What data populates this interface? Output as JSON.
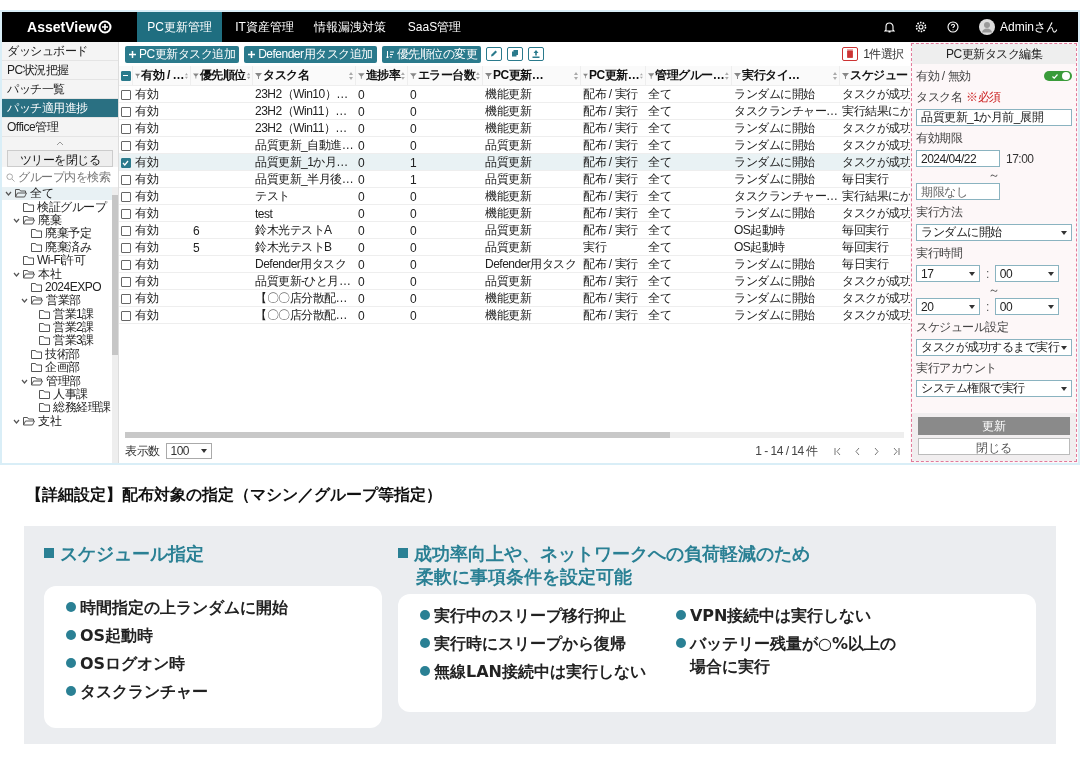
{
  "header": {
    "logo": "AssetView",
    "tabs": [
      {
        "label": "PC更新管理",
        "selected": true
      },
      {
        "label": "IT資産管理",
        "selected": false
      },
      {
        "label": "情報漏洩対策",
        "selected": false
      },
      {
        "label": "SaaS管理",
        "selected": false
      }
    ],
    "user": "Adminさん"
  },
  "sidebar": {
    "menu": [
      {
        "label": "ダッシュボード",
        "selected": false
      },
      {
        "label": "PC状況把握",
        "selected": false
      },
      {
        "label": "パッチ一覧",
        "selected": false
      },
      {
        "label": "パッチ適用進捗",
        "selected": true
      },
      {
        "label": "Office管理",
        "selected": false
      }
    ],
    "collapse_button": "ツリーを閉じる",
    "search": {
      "placeholder": "グループ内を検索"
    },
    "tree": [
      {
        "label": "全て",
        "expanded": true,
        "selected": true,
        "children": [
          {
            "label": "検証グループ",
            "selected": false
          },
          {
            "label": "廃棄",
            "expanded": true,
            "selected": false,
            "children": [
              {
                "label": "廃棄予定",
                "selected": false
              },
              {
                "label": "廃棄済み",
                "selected": false
              }
            ]
          },
          {
            "label": "Wi-Fi許可",
            "selected": false
          },
          {
            "label": "本社",
            "expanded": true,
            "selected": false,
            "children": [
              {
                "label": "2024EXPO",
                "selected": false
              },
              {
                "label": "営業部",
                "expanded": true,
                "selected": false,
                "children": [
                  {
                    "label": "営業1課",
                    "selected": false
                  },
                  {
                    "label": "営業2課",
                    "selected": false
                  },
                  {
                    "label": "営業3課",
                    "selected": false
                  }
                ]
              },
              {
                "label": "技術部",
                "selected": false
              },
              {
                "label": "企画部",
                "selected": false
              },
              {
                "label": "管理部",
                "expanded": true,
                "selected": false,
                "children": [
                  {
                    "label": "人事課",
                    "selected": false
                  },
                  {
                    "label": "総務経理課",
                    "selected": false
                  }
                ]
              }
            ]
          },
          {
            "label": "支社",
            "expanded": true,
            "selected": false
          }
        ]
      }
    ]
  },
  "toolbar": {
    "buttons": [
      "PC更新タスク追加",
      "Defender用タスク追加",
      "優先順位の変更"
    ],
    "selection_count": "1件選択"
  },
  "table": {
    "select_all_indeterminate": true,
    "columns": [
      "有効 / …",
      "優先順位",
      "タスク名",
      "進捗率",
      "エラー台数",
      "PC更新…",
      "PC更新…",
      "管理グルー…",
      "実行タイ…",
      "スケジュー"
    ],
    "rows": [
      {
        "selected": false,
        "cells": [
          "有効",
          null,
          "23H2（Win10）…",
          "0",
          "0",
          "機能更新",
          "配布 / 実行",
          "全て",
          "ランダムに開始",
          "タスクが成功"
        ]
      },
      {
        "selected": false,
        "cells": [
          "有効",
          null,
          "23H2（Win11）…",
          "0",
          "0",
          "機能更新",
          "配布 / 実行",
          "全て",
          "タスクランチャー…",
          "実行結果にか"
        ]
      },
      {
        "selected": false,
        "cells": [
          "有効",
          null,
          "23H2（Win11）…",
          "0",
          "0",
          "機能更新",
          "配布 / 実行",
          "全て",
          "ランダムに開始",
          "タスクが成功"
        ]
      },
      {
        "selected": false,
        "cells": [
          "有効",
          null,
          "品質更新_自動進…",
          "0",
          "0",
          "品質更新",
          "配布 / 実行",
          "全て",
          "ランダムに開始",
          "タスクが成功"
        ]
      },
      {
        "selected": true,
        "cells": [
          "有効",
          null,
          "品質更新_1か月…",
          "0",
          "1",
          "品質更新",
          "配布 / 実行",
          "全て",
          "ランダムに開始",
          "タスクが成功"
        ]
      },
      {
        "selected": false,
        "cells": [
          "有効",
          null,
          "品質更新_半月後…",
          "0",
          "1",
          "品質更新",
          "配布 / 実行",
          "全て",
          "ランダムに開始",
          "毎日実行"
        ]
      },
      {
        "selected": false,
        "cells": [
          "有効",
          null,
          "テスト",
          "0",
          "0",
          "機能更新",
          "配布 / 実行",
          "全て",
          "タスクランチャー…",
          "実行結果にか"
        ]
      },
      {
        "selected": false,
        "cells": [
          "有効",
          null,
          "test",
          "0",
          "0",
          "機能更新",
          "配布 / 実行",
          "全て",
          "ランダムに開始",
          "タスクが成功"
        ]
      },
      {
        "selected": false,
        "cells": [
          "有効",
          "6",
          "鈴木光テストA",
          "0",
          "0",
          "品質更新",
          "配布 / 実行",
          "全て",
          "OS起動時",
          "毎回実行"
        ]
      },
      {
        "selected": false,
        "cells": [
          "有効",
          "5",
          "鈴木光テストB",
          "0",
          "0",
          "品質更新",
          "実行",
          "全て",
          "OS起動時",
          "毎回実行"
        ]
      },
      {
        "selected": false,
        "cells": [
          "有効",
          null,
          "Defender用タスク",
          "0",
          "0",
          "Defender用タスク",
          "配布 / 実行",
          "全て",
          "ランダムに開始",
          "毎日実行"
        ]
      },
      {
        "selected": false,
        "cells": [
          "有効",
          null,
          "品質更新-ひと月…",
          "0",
          "0",
          "品質更新",
          "配布 / 実行",
          "全て",
          "ランダムに開始",
          "タスクが成功"
        ]
      },
      {
        "selected": false,
        "cells": [
          "有効",
          null,
          "【〇〇店分散配…",
          "0",
          "0",
          "機能更新",
          "配布 / 実行",
          "全て",
          "ランダムに開始",
          "タスクが成功"
        ]
      },
      {
        "selected": false,
        "cells": [
          "有効",
          null,
          "【〇〇店分散配…",
          "0",
          "0",
          "機能更新",
          "配布 / 実行",
          "全て",
          "ランダムに開始",
          "タスクが成功"
        ]
      }
    ]
  },
  "pager": {
    "page_size_label": "表示数",
    "page_size": "100",
    "range": "1 - 14 / 14 件"
  },
  "panel": {
    "title": "PC更新タスク編集",
    "enabled_label": "有効 / 無効",
    "enabled": true,
    "task_name": {
      "label": "タスク名",
      "required": "※必須",
      "value": "品質更新_1か月前_展開"
    },
    "expiry": {
      "label": "有効期限",
      "start_date": "2024/04/22",
      "start_time": "17:00",
      "tilde": "～",
      "end_placeholder": "期限なし"
    },
    "method": {
      "label": "実行方法",
      "value": "ランダムに開始"
    },
    "time": {
      "label": "実行時間",
      "ranges": [
        {
          "hour": "17",
          "colon": ":",
          "minute": "00"
        },
        {
          "hour": "20",
          "colon": ":",
          "minute": "00"
        }
      ],
      "tilde": "～"
    },
    "schedule": {
      "label": "スケジュール設定",
      "value": "タスクが成功するまで実行"
    },
    "account": {
      "label": "実行アカウント",
      "value": "システム権限で実行"
    },
    "update_button": {
      "label": "更新",
      "disabled": true
    },
    "close_button": "閉じる"
  },
  "caption": "【詳細設定】配布対象の指定（マシン／グループ等指定）",
  "features": {
    "left": {
      "heading": [
        "スケジュール指定"
      ],
      "columns": [
        [
          "時間指定の上ランダムに開始",
          "OS起動時",
          "OSログオン時",
          "タスクランチャー"
        ]
      ]
    },
    "right": {
      "heading": [
        "成功率向上や、ネットワークへの負荷軽減のため",
        "柔軟に事項条件を設定可能"
      ],
      "columns": [
        [
          "実行中のスリープ移行抑止",
          "実行時にスリープから復帰",
          "無線LAN接続中は実行しない"
        ],
        [
          "VPN接続中は実行しない",
          "バッテリー残量が○%以上の場合に実行"
        ]
      ]
    }
  }
}
